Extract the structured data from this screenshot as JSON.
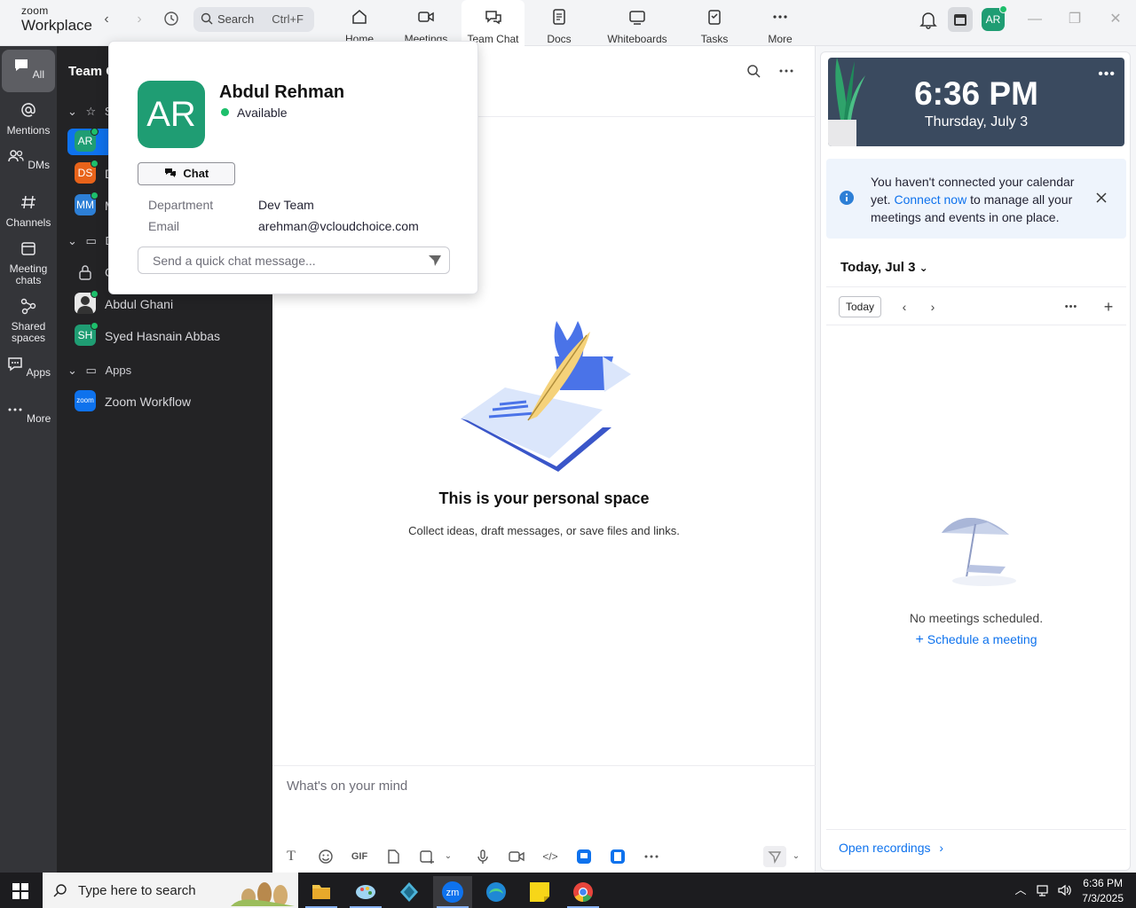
{
  "app": {
    "brand_small": "zoom",
    "brand_big": "Workplace"
  },
  "search": {
    "label": "Search",
    "shortcut": "Ctrl+F"
  },
  "top_tabs": [
    {
      "label": "Home",
      "icon": "home-icon"
    },
    {
      "label": "Meetings",
      "icon": "video-icon"
    },
    {
      "label": "Team Chat",
      "icon": "chat-icon",
      "active": true
    },
    {
      "label": "Docs",
      "icon": "doc-icon"
    },
    {
      "label": "Whiteboards",
      "icon": "whiteboard-icon"
    },
    {
      "label": "Tasks",
      "icon": "tasks-icon"
    },
    {
      "label": "More",
      "icon": "more-icon"
    }
  ],
  "user_avatar": "AR",
  "rail": [
    {
      "label": "All",
      "icon": "chat-bubble-icon",
      "active": true
    },
    {
      "label": "Mentions",
      "icon": "at-icon"
    },
    {
      "label": "DMs",
      "icon": "people-icon"
    },
    {
      "label": "Channels",
      "icon": "hash-icon"
    },
    {
      "label": "Meeting chats",
      "icon": "calendar-icon"
    },
    {
      "label": "Shared spaces",
      "icon": "shared-icon"
    },
    {
      "label": "Apps",
      "icon": "apps-icon"
    },
    {
      "label": "More",
      "icon": "more-icon"
    }
  ],
  "listpanel": {
    "title": "Team C",
    "starred_section": "S",
    "dms_section": "D",
    "rows": [
      {
        "initials": "AR",
        "name": "",
        "color": "#1f9d73",
        "online": true,
        "selected": true
      },
      {
        "initials": "DS",
        "name": "D",
        "color": "#e8631a",
        "online": true
      },
      {
        "initials": "MM",
        "name": "M",
        "color": "#2d7fd6",
        "online": true
      },
      {
        "initials": "",
        "name": "C",
        "color": "",
        "online": false
      },
      {
        "initials": "",
        "name": "Abdul Ghani",
        "color": "#8a8a8a",
        "online": true
      },
      {
        "initials": "SH",
        "name": "Syed Hasnain Abbas",
        "color": "#1f9d73",
        "online": true
      }
    ],
    "apps_section": "Apps",
    "apps": [
      {
        "initials": "zoom",
        "name": "Zoom Workflow",
        "color": "#0e72ed"
      }
    ]
  },
  "main": {
    "empty_title": "This is your personal space",
    "empty_subtitle": "Collect ideas, draft messages, or save files and links.",
    "composer_placeholder": "What's on your mind",
    "gif_label": "GIF"
  },
  "popup": {
    "initials": "AR",
    "name": "Abdul Rehman",
    "status": "Available",
    "chat_label": "Chat",
    "department_label": "Department",
    "department_value": "Dev Team",
    "email_label": "Email",
    "email_value": "arehman@vcloudchoice.com",
    "message_placeholder": "Send a quick chat message..."
  },
  "calendar": {
    "time": "6:36 PM",
    "date": "Thursday, July 3",
    "notice_before": "You haven't connected your calendar yet. ",
    "notice_link": "Connect now",
    "notice_after": " to manage all your meetings and events in one place.",
    "date_header": "Today, Jul 3",
    "today_label": "Today",
    "no_meetings": "No meetings scheduled.",
    "schedule_label": "Schedule a meeting",
    "open_recordings": "Open recordings"
  },
  "taskbar": {
    "search_placeholder": "Type here to search",
    "time": "6:36 PM",
    "date": "7/3/2025"
  },
  "colors": {
    "accent": "#0e72ed",
    "online": "#1dbf6b",
    "rail_bg": "#343539",
    "list_bg": "#232325"
  }
}
